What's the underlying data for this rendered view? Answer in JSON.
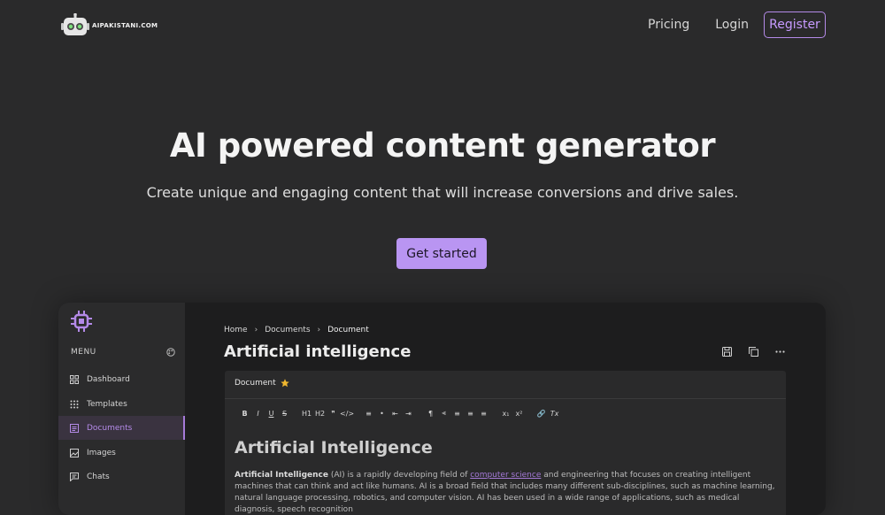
{
  "nav": {
    "logo_text": "AIPAKISTANI.COM",
    "links": [
      "Pricing",
      "Login"
    ],
    "register": "Register"
  },
  "hero": {
    "title": "AI powered content generator",
    "subtitle": "Create unique and engaging content that will increase conversions and drive sales.",
    "cta": "Get started"
  },
  "preview": {
    "menu_label": "MENU",
    "sidebar": [
      {
        "label": "Dashboard",
        "icon": "dashboard-icon"
      },
      {
        "label": "Templates",
        "icon": "templates-icon"
      },
      {
        "label": "Documents",
        "icon": "documents-icon",
        "active": true
      },
      {
        "label": "Images",
        "icon": "images-icon"
      },
      {
        "label": "Chats",
        "icon": "chats-icon"
      }
    ],
    "breadcrumb": [
      "Home",
      "Documents",
      "Document"
    ],
    "doc_title": "Artificial intelligence",
    "editor": {
      "tab": "Document",
      "toolbar": [
        "B",
        "I",
        "U",
        "S",
        "H1",
        "H2",
        "❞",
        "</>",
        "≡",
        "•",
        "⇤",
        "⇥",
        "¶",
        "⫷",
        "≡",
        "≡",
        "≡",
        "x₁",
        "x²",
        "🔗",
        "Tx"
      ],
      "heading": "Artificial Intelligence",
      "body_bold": "Artificial Intelligence",
      "body_1": " (AI) is a rapidly developing field of ",
      "body_link": "computer science",
      "body_2": " and engineering that focuses on creating intelligent machines that can think and act like humans. AI is a broad field that includes many different sub-disciplines, such as machine learning, natural language processing, robotics, and computer vision. AI has been used in a wide range of applications, such as medical diagnosis, speech recognition"
    }
  },
  "colors": {
    "accent": "#b995f2",
    "background": "#2a2a2b",
    "panel": "#1d1d1e"
  }
}
